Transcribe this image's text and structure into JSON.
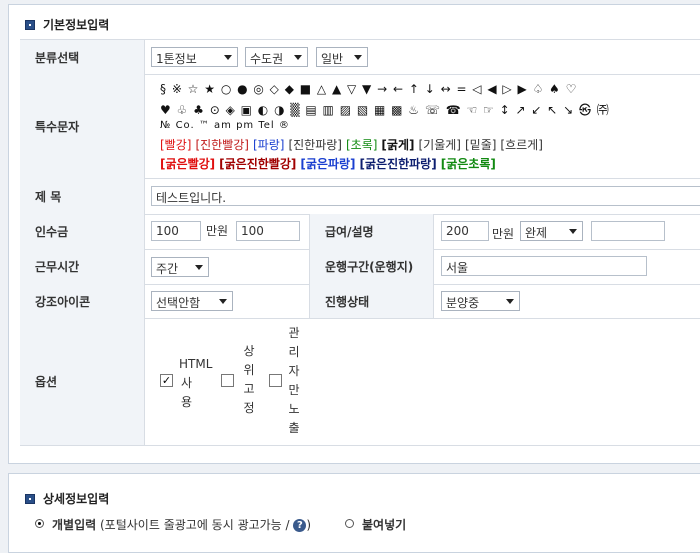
{
  "section1": {
    "title": "기본정보입력"
  },
  "category": {
    "label": "분류선택",
    "select1": "1톤정보",
    "select2": "수도권",
    "select3": "일반"
  },
  "special": {
    "label": "특수문자",
    "line1": "§ ※ ☆ ★ ○ ● ◎ ◇ ◆ ■ △ ▲ ▽ ▼ → ← ↑ ↓ ↔ = ◁ ◀ ▷ ▶ ♤ ♠ ♡",
    "line2": "♥ ♧ ♣ ⊙ ◈ ▣ ◐ ◑ ▒ ▤ ▥ ▨ ▧ ▦ ▩ ♨ ☏ ☎ ☜ ☞ ↕ ↗ ↙ ↖ ↘ ㉿ ㈜",
    "line3": "№ Co. ™ am pm Tel ®",
    "fmt_row1": [
      "[빨강]",
      "[진한빨강]",
      "[파랑]",
      "[진한파랑]",
      "[초록]",
      "[굵게]",
      "[기울게]",
      "[밑줄]",
      "[흐르게]"
    ],
    "fmt_row2": [
      "[굵은빨강]",
      "[굵은진한빨강]",
      "[굵은파랑]",
      "[굵은진한파랑]",
      "[굵은초록]"
    ]
  },
  "title_row": {
    "label": "제 목",
    "value": "테스트입니다."
  },
  "fee": {
    "label": "인수금",
    "value1": "100",
    "unit": "만원",
    "value2": "100"
  },
  "pay": {
    "label": "급여/설명",
    "value": "200",
    "unit": "만원",
    "select": "완제",
    "extra": ""
  },
  "hours": {
    "label": "근무시간",
    "select": "주간"
  },
  "route": {
    "label": "운행구간(운행지)",
    "value": "서울"
  },
  "icon": {
    "label": "강조아이콘",
    "select": "선택안함"
  },
  "status": {
    "label": "진행상태",
    "select": "분양중"
  },
  "options": {
    "label": "옵션",
    "opt1": [
      "HTML",
      "사",
      "용"
    ],
    "opt2": [
      "상",
      "위",
      "고",
      "정"
    ],
    "opt3": [
      "관",
      "리",
      "자",
      "만",
      "노",
      "출"
    ],
    "opt1_checked": true,
    "opt2_checked": false,
    "opt3_checked": false
  },
  "section2": {
    "title": "상세정보입력",
    "radio1_label": "개별입력",
    "radio1_note": "(포털사이트 줄광고에 동시 광고가능 /",
    "help": "?",
    "help_close": ")",
    "radio2_label": "붙여넣기"
  },
  "colors": {
    "red": "#e01010",
    "dark_red": "#a00000",
    "blue": "#1a3fd0",
    "dark_blue": "#0c1d6e",
    "green": "#118a11",
    "accent": "#2a4f88"
  }
}
